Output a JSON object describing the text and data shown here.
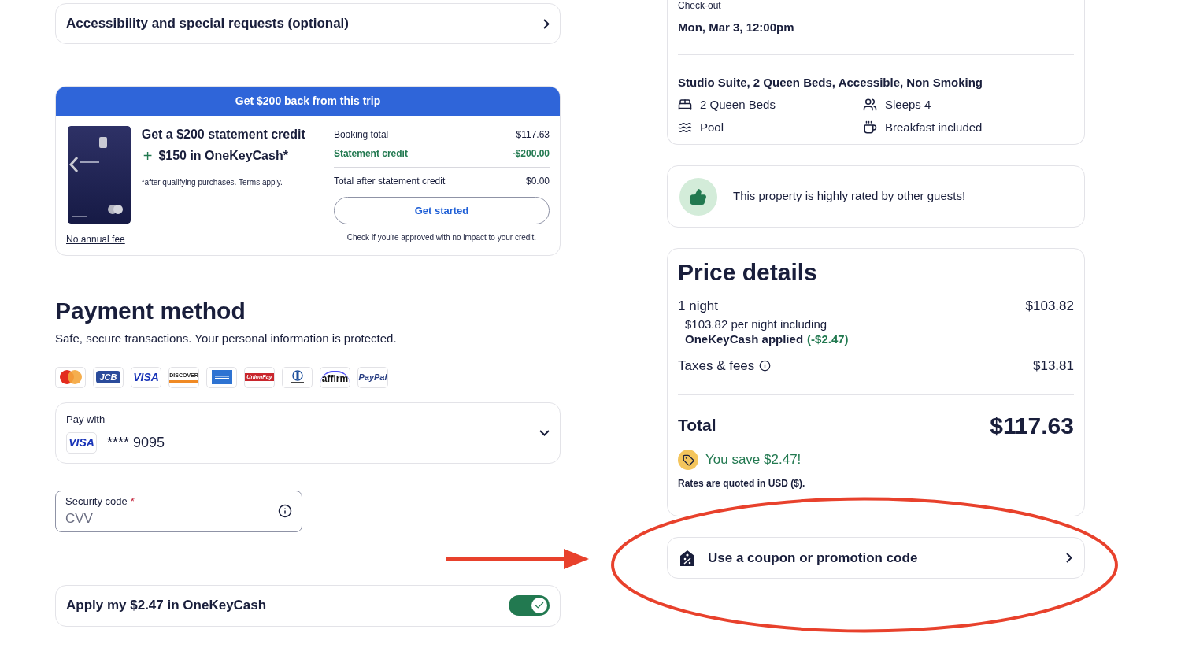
{
  "accessibility_row": {
    "label": "Accessibility and special requests (optional)"
  },
  "promo": {
    "banner": "Get $200 back from this trip",
    "no_fee_link": "No annual fee",
    "headline": "Get a $200 statement credit",
    "plus": "+",
    "bonus": "$150 in OneKeyCash*",
    "fine_print": "*after qualifying purchases. Terms apply.",
    "lines": [
      {
        "label": "Booking total",
        "value": "$117.63",
        "kind": "plain"
      },
      {
        "label": "Statement credit",
        "value": "-$200.00",
        "kind": "credit"
      },
      {
        "label": "Total after statement credit",
        "value": "$0.00",
        "kind": "total"
      }
    ],
    "button": "Get started",
    "note": "Check if you're approved with no impact to your credit."
  },
  "payment": {
    "title": "Payment method",
    "subtitle": "Safe, secure transactions. Your personal information is protected.",
    "brands": [
      {
        "kind": "mastercard"
      },
      {
        "kind": "jcb",
        "label": "JCB"
      },
      {
        "kind": "visa",
        "label": "VISA"
      },
      {
        "kind": "discover",
        "label": "DISCOVER"
      },
      {
        "kind": "amex"
      },
      {
        "kind": "unionpay",
        "label": "UnionPay"
      },
      {
        "kind": "diners"
      },
      {
        "kind": "affirm",
        "label": "affirm"
      },
      {
        "kind": "paypal",
        "label": "PayPal"
      }
    ],
    "pay_with": {
      "label": "Pay with",
      "brand": "VISA",
      "number": "**** 9095"
    },
    "security_code": {
      "label": "Security code",
      "required": "*",
      "placeholder": "CVV"
    },
    "onekeycash": {
      "label": "Apply my $2.47 in OneKeyCash",
      "on": true
    }
  },
  "stay": {
    "checkout_label": "Check-out",
    "checkout_value": "Mon, Mar 3, 12:00pm",
    "room": "Studio Suite, 2 Queen Beds, Accessible, Non Smoking",
    "amenities": [
      {
        "kind": "bed",
        "label": "2 Queen Beds"
      },
      {
        "kind": "people",
        "label": "Sleeps 4"
      },
      {
        "kind": "pool",
        "label": "Pool"
      },
      {
        "kind": "cup",
        "label": "Breakfast included"
      }
    ]
  },
  "rating_note": "This property is highly rated by other guests!",
  "price_details": {
    "title": "Price details",
    "night_label": "1 night",
    "night_value": "$103.82",
    "night_detail": "$103.82 per night including",
    "applied_label": "OneKeyCash applied",
    "applied_value": "(-$2.47)",
    "taxes_label": "Taxes & fees",
    "taxes_value": "$13.81",
    "total_label": "Total",
    "total_value": "$117.63",
    "savings": "You save $2.47!",
    "currency_note": "Rates are quoted in USD ($)."
  },
  "coupon": {
    "label": "Use a coupon or promotion code"
  }
}
